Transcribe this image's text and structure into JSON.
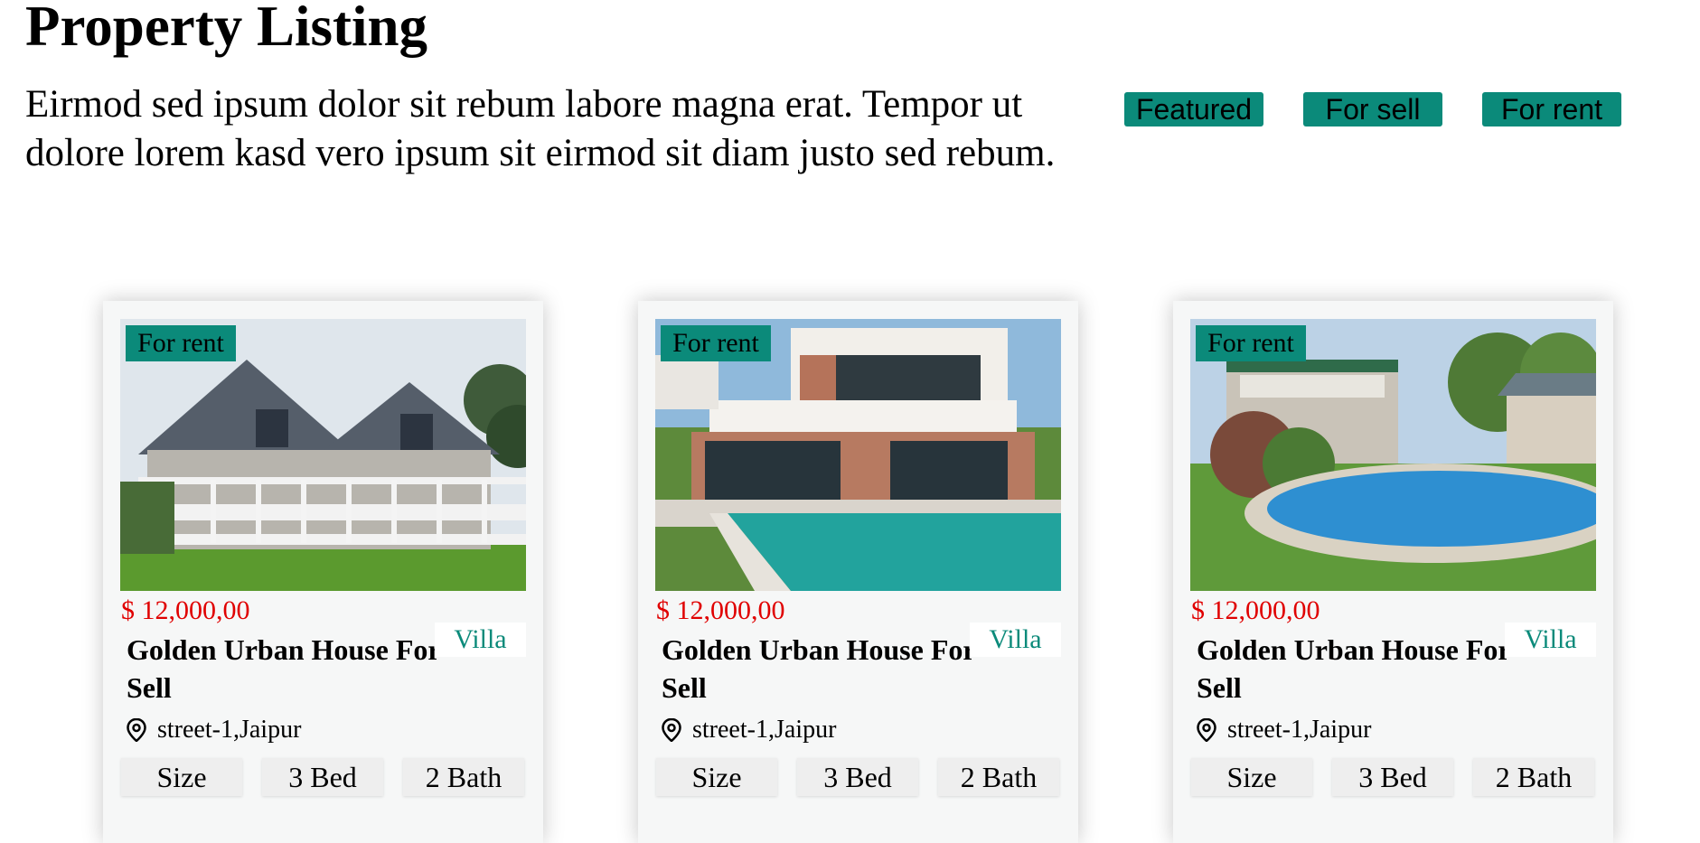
{
  "page": {
    "title": "Property Listing",
    "intro": "Eirmod sed ipsum dolor sit rebum labore magna erat. Tempor ut dolore lorem kasd vero ipsum sit eirmod sit diam justo sed rebum."
  },
  "filters": [
    {
      "label": "Featured"
    },
    {
      "label": "For sell"
    },
    {
      "label": "For rent"
    }
  ],
  "colors": {
    "accent": "#0b8a7a",
    "price": "#e00000"
  },
  "listings": [
    {
      "badge": "For rent",
      "price": "$ 12,000,00",
      "title": "Golden Urban House For Sell",
      "category": "Villa",
      "location_icon": "location-pin-icon",
      "location": "street-1,Jaipur",
      "features": [
        "Size",
        "3 Bed",
        "2 Bath"
      ]
    },
    {
      "badge": "For rent",
      "price": "$ 12,000,00",
      "title": "Golden Urban House For Sell",
      "category": "Villa",
      "location_icon": "location-pin-icon",
      "location": "street-1,Jaipur",
      "features": [
        "Size",
        "3 Bed",
        "2 Bath"
      ]
    },
    {
      "badge": "For rent",
      "price": "$ 12,000,00",
      "title": "Golden Urban House For Sell",
      "category": "Villa",
      "location_icon": "location-pin-icon",
      "location": "street-1,Jaipur",
      "features": [
        "Size",
        "3 Bed",
        "2 Bath"
      ]
    }
  ]
}
